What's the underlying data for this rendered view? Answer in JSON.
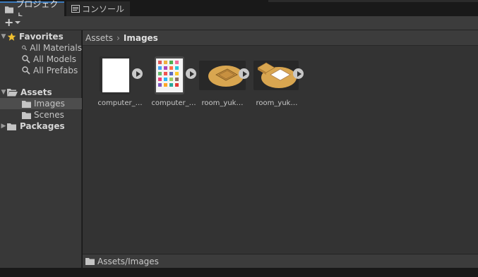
{
  "tabs": [
    {
      "label": "プロジェクト",
      "icon": "folder-icon",
      "active": true
    },
    {
      "label": "コンソール",
      "icon": "console-icon",
      "active": false
    }
  ],
  "toolbar": {
    "add_label": "+",
    "add_dropdown_icon": "chevron-down-icon"
  },
  "sidebar": {
    "favorites": {
      "label": "Favorites",
      "items": [
        "All Materials",
        "All Models",
        "All Prefabs"
      ]
    },
    "assets": {
      "label": "Assets",
      "children": [
        "Images",
        "Scenes"
      ],
      "selected": "Images"
    },
    "packages": {
      "label": "Packages"
    }
  },
  "breadcrumb": {
    "root": "Assets",
    "current": "Images"
  },
  "assets": [
    {
      "name": "computer_…",
      "type": "tablet-blank"
    },
    {
      "name": "computer_…",
      "type": "tablet-apps"
    },
    {
      "name": "room_yuk…",
      "type": "room-floor"
    },
    {
      "name": "room_yuk…",
      "type": "room-items"
    }
  ],
  "status": {
    "path": "Assets/Images"
  },
  "colors": {
    "accent": "#3a79bb",
    "favorite_star": "#f0c030",
    "wood": "#d9a650"
  }
}
